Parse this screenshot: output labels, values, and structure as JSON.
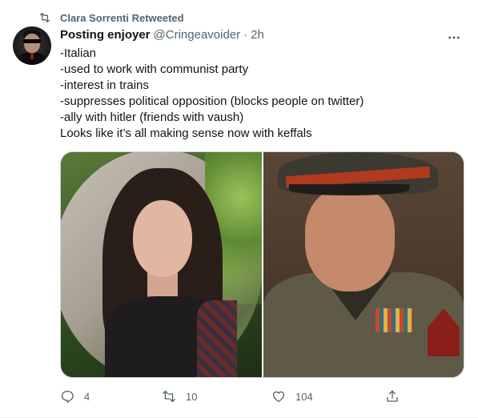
{
  "retweet_context": {
    "label": "Clara Sorrenti Retweeted"
  },
  "tweet": {
    "display_name": "Posting enjoyer",
    "handle": "@Cringeavoider",
    "separator": "·",
    "time": "2h",
    "lines": [
      "-Italian",
      "-used to work with communist party",
      "-interest in trains",
      "-suppresses political opposition (blocks people on twitter)",
      "-ally with hitler (friends with vaush)",
      "Looks like it’s all making sense now with keffals"
    ]
  },
  "actions": {
    "reply_count": "4",
    "retweet_count": "10",
    "like_count": "104"
  },
  "icons": {
    "retweet": "retweet-icon",
    "more": "more-icon",
    "reply": "reply-icon",
    "like": "heart-icon",
    "share": "share-icon"
  },
  "colors": {
    "text": "#0f1419",
    "secondary": "#536471",
    "border": "#cfd9de"
  }
}
